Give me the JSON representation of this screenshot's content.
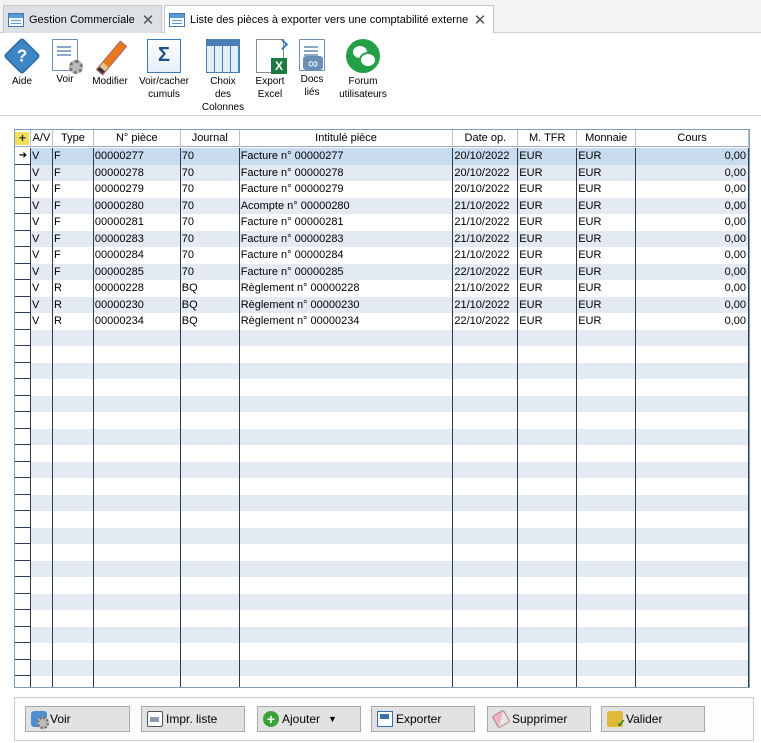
{
  "tabs": [
    {
      "label": "Gestion Commerciale",
      "close": "✕"
    },
    {
      "label": "Liste des pièces à exporter vers une comptabilité externe",
      "close": "✕"
    }
  ],
  "toolbar": {
    "aide": "Aide",
    "voir": "Voir",
    "modifier": "Modifier",
    "voir_cacher_1": "Voir/cacher",
    "voir_cacher_2": "cumuls",
    "choix_1": "Choix",
    "choix_2": "des",
    "choix_3": "Colonnes",
    "export_1": "Export",
    "export_2": "Excel",
    "docs_1": "Docs",
    "docs_2": "liés",
    "forum_1": "Forum",
    "forum_2": "utilisateurs"
  },
  "grid": {
    "corner": "+",
    "row_marker": "➜",
    "columns": [
      "A/V",
      "Type",
      "N° pièce",
      "Journal",
      "Intitulé pièce",
      "Date op.",
      "M. TFR",
      "Monnaie",
      "Cours"
    ],
    "rows": [
      [
        "V",
        "F",
        "00000277",
        "70",
        "Facture n° 00000277",
        "20/10/2022",
        "EUR",
        "EUR",
        "0,00"
      ],
      [
        "V",
        "F",
        "00000278",
        "70",
        "Facture n° 00000278",
        "20/10/2022",
        "EUR",
        "EUR",
        "0,00"
      ],
      [
        "V",
        "F",
        "00000279",
        "70",
        "Facture n° 00000279",
        "20/10/2022",
        "EUR",
        "EUR",
        "0,00"
      ],
      [
        "V",
        "F",
        "00000280",
        "70",
        "Acompte n° 00000280",
        "21/10/2022",
        "EUR",
        "EUR",
        "0,00"
      ],
      [
        "V",
        "F",
        "00000281",
        "70",
        "Facture n° 00000281",
        "21/10/2022",
        "EUR",
        "EUR",
        "0,00"
      ],
      [
        "V",
        "F",
        "00000283",
        "70",
        "Facture n° 00000283",
        "21/10/2022",
        "EUR",
        "EUR",
        "0,00"
      ],
      [
        "V",
        "F",
        "00000284",
        "70",
        "Facture n° 00000284",
        "21/10/2022",
        "EUR",
        "EUR",
        "0,00"
      ],
      [
        "V",
        "F",
        "00000285",
        "70",
        "Facture n° 00000285",
        "22/10/2022",
        "EUR",
        "EUR",
        "0,00"
      ],
      [
        "V",
        "R",
        "00000228",
        "BQ",
        "Règlement n° 00000228",
        "21/10/2022",
        "EUR",
        "EUR",
        "0,00"
      ],
      [
        "V",
        "R",
        "00000230",
        "BQ",
        "Règlement n° 00000230",
        "21/10/2022",
        "EUR",
        "EUR",
        "0,00"
      ],
      [
        "V",
        "R",
        "00000234",
        "BQ",
        "Règlement n° 00000234",
        "22/10/2022",
        "EUR",
        "EUR",
        "0,00"
      ]
    ]
  },
  "buttons": {
    "voir": "Voir",
    "impr": "Impr. liste",
    "ajouter": "Ajouter",
    "ajouter_caret": "▼",
    "exporter": "Exporter",
    "supprimer": "Supprimer",
    "valider": "Valider"
  },
  "colors": {
    "selected_row": "#c9dcef",
    "alt_row": "#e4eaf2",
    "grid_line": "#2d3c50"
  }
}
